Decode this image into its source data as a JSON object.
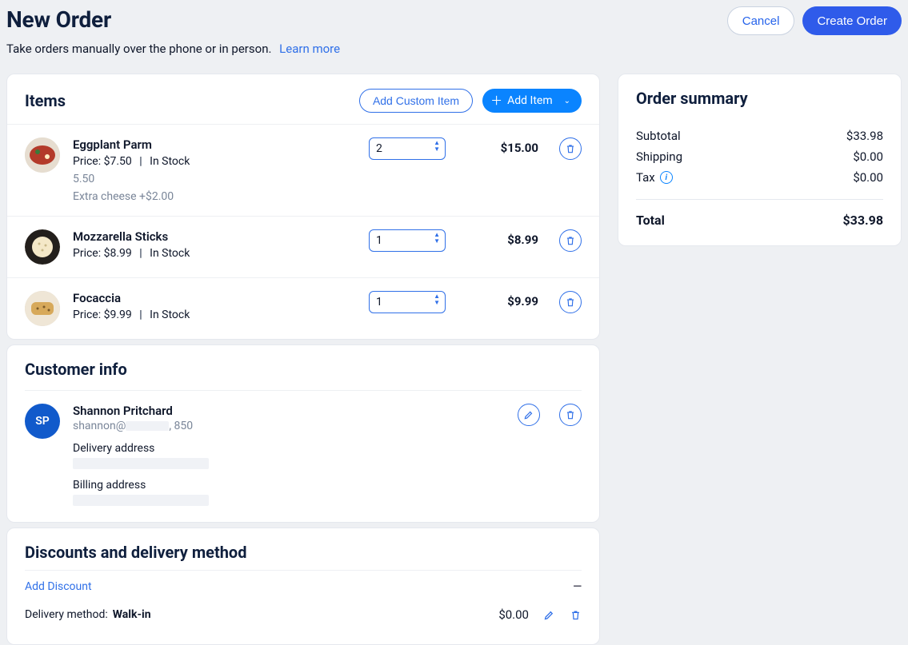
{
  "header": {
    "title": "New Order",
    "subtitle": "Take orders manually over the phone or in person.",
    "learn_more": "Learn more",
    "cancel": "Cancel",
    "create": "Create Order"
  },
  "items_card": {
    "title": "Items",
    "add_custom": "Add Custom Item",
    "add_item": "Add Item"
  },
  "items": [
    {
      "name": "Eggplant Parm",
      "price_label": "Price: $7.50",
      "stock": "In Stock",
      "qty": "2",
      "line_total": "$15.00",
      "extra1": "5.50",
      "extra2": "Extra cheese +$2.00"
    },
    {
      "name": "Mozzarella Sticks",
      "price_label": "Price: $8.99",
      "stock": "In Stock",
      "qty": "1",
      "line_total": "$8.99"
    },
    {
      "name": "Focaccia",
      "price_label": "Price: $9.99",
      "stock": "In Stock",
      "qty": "1",
      "line_total": "$9.99"
    }
  ],
  "customer_card": {
    "title": "Customer info",
    "initials": "SP",
    "name": "Shannon Pritchard",
    "email_prefix": "shannon@",
    "email_suffix": ", 850",
    "delivery_label": "Delivery address",
    "billing_label": "Billing address"
  },
  "discounts_card": {
    "title": "Discounts and delivery method",
    "add_discount": "Add Discount",
    "dash": "—",
    "delivery_label": "Delivery method:",
    "delivery_value": "Walk-in",
    "delivery_price": "$0.00"
  },
  "summary": {
    "title": "Order summary",
    "subtotal_label": "Subtotal",
    "subtotal_value": "$33.98",
    "shipping_label": "Shipping",
    "shipping_value": "$0.00",
    "tax_label": "Tax",
    "tax_value": "$0.00",
    "total_label": "Total",
    "total_value": "$33.98"
  }
}
